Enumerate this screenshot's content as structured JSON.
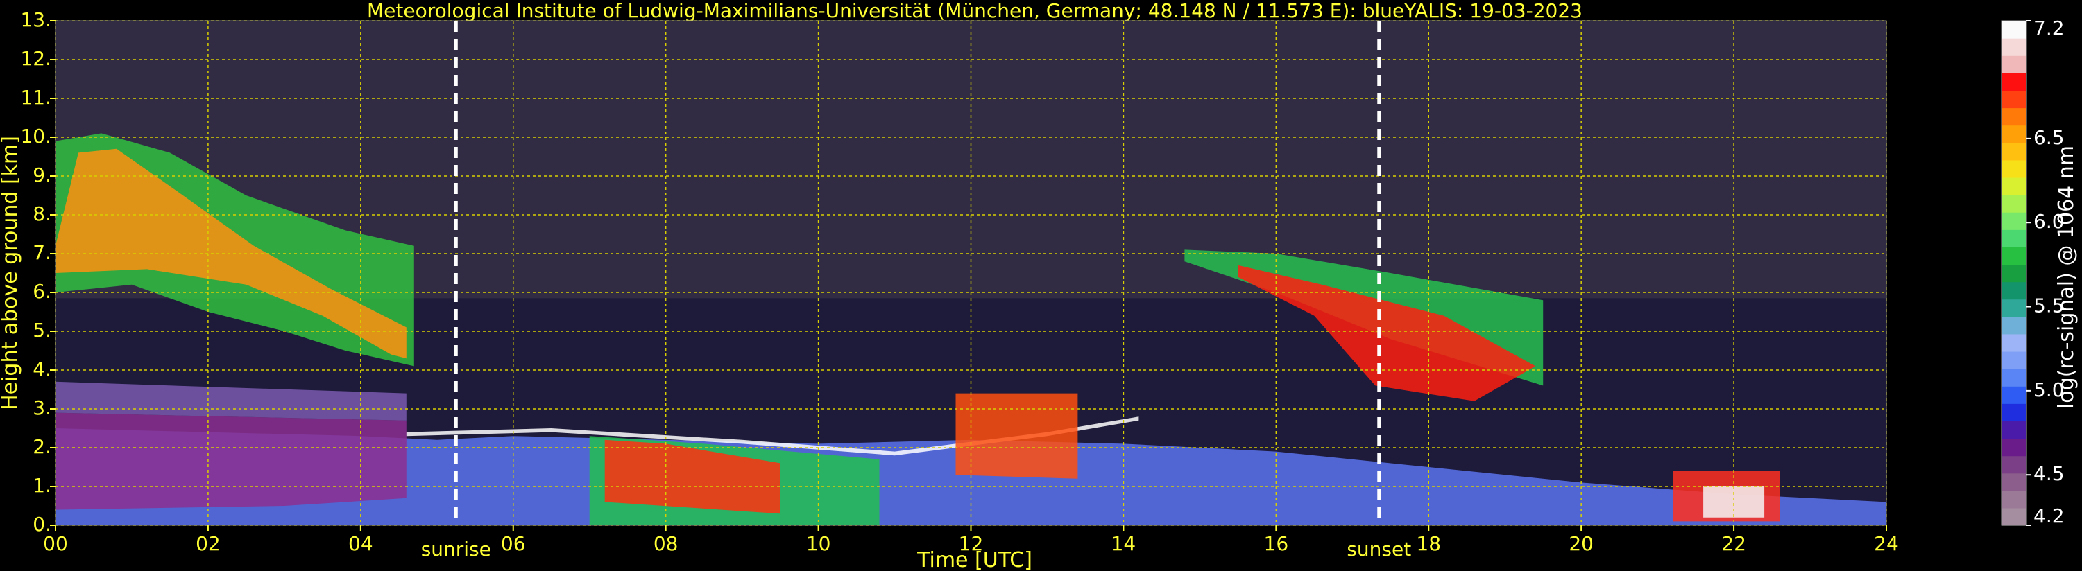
{
  "chart_data": {
    "type": "heatmap",
    "title": "Meteorological Institute of Ludwig-Maximilians-Universität (München, Germany; 48.148 N / 11.573 E):     blueYALIS: 19-03-2023",
    "xlabel": "Time [UTC]",
    "ylabel": "Height above ground [km]",
    "xlim": [
      0,
      24
    ],
    "ylim": [
      0,
      13
    ],
    "x_ticks": [
      "00",
      "02",
      "04",
      "06",
      "08",
      "10",
      "12",
      "14",
      "16",
      "18",
      "20",
      "22",
      "24"
    ],
    "y_ticks": [
      "0.",
      "1.",
      "2.",
      "3.",
      "4.",
      "5.",
      "6.",
      "7.",
      "8.",
      "9.",
      "10.",
      "11.",
      "12.",
      "13."
    ],
    "grid": true,
    "annotations": [
      {
        "label": "sunrise",
        "x": 5.25
      },
      {
        "label": "sunset",
        "x": 17.35
      }
    ],
    "colorbar": {
      "label": "log(rc-signal) @ 1064 nm",
      "range": [
        4.2,
        7.2
      ],
      "tick_labels": [
        "4.2",
        "4.5",
        "5.0",
        "5.5",
        "6.0",
        "6.5",
        "7.2"
      ],
      "ticks": [
        4.2,
        4.5,
        5.0,
        5.5,
        6.0,
        6.5,
        7.2
      ],
      "colors": [
        "#a48ea0",
        "#9a7a96",
        "#8c5e8c",
        "#7a3f86",
        "#6a1c8a",
        "#4a1aa8",
        "#1f2fe0",
        "#2f5cf2",
        "#5a86f5",
        "#7f9ef6",
        "#9db5f7",
        "#6fb0d8",
        "#2fa89a",
        "#14946a",
        "#18a040",
        "#28c040",
        "#4cd870",
        "#78e86a",
        "#a8f050",
        "#d8f030",
        "#f8e018",
        "#ffc010",
        "#ffa008",
        "#ff7a08",
        "#ff4010",
        "#ff1010",
        "#f0b8b8",
        "#f5d8d8",
        "#fafafa"
      ]
    },
    "layers": [
      {
        "name": "near-surface aerosol",
        "color": "#5a74ee",
        "poly": [
          [
            0,
            0
          ],
          [
            24,
            0
          ],
          [
            24,
            0.6
          ],
          [
            22,
            0.8
          ],
          [
            20,
            1.1
          ],
          [
            18,
            1.5
          ],
          [
            16,
            1.9
          ],
          [
            14,
            2.1
          ],
          [
            12,
            2.2
          ],
          [
            10,
            2.1
          ],
          [
            8,
            2.2
          ],
          [
            6,
            2.3
          ],
          [
            5,
            2.2
          ],
          [
            4,
            2.3
          ],
          [
            2,
            2.4
          ],
          [
            0,
            2.5
          ]
        ]
      },
      {
        "name": "residual layer",
        "color": "#8c2f90",
        "poly": [
          [
            0,
            0.4
          ],
          [
            3,
            0.5
          ],
          [
            4.6,
            0.7
          ],
          [
            4.6,
            2.7
          ],
          [
            0,
            2.9
          ]
        ]
      },
      {
        "name": "upper aerosol",
        "color": "#7a5ab0",
        "poly": [
          [
            0,
            2.9
          ],
          [
            4.6,
            2.7
          ],
          [
            4.6,
            3.4
          ],
          [
            0,
            3.7
          ]
        ]
      },
      {
        "name": "cirrus morning",
        "color": "#30c040",
        "poly": [
          [
            0,
            6
          ],
          [
            1,
            6.2
          ],
          [
            2,
            5.5
          ],
          [
            3,
            5
          ],
          [
            3.8,
            4.5
          ],
          [
            4.7,
            4.1
          ],
          [
            4.7,
            7.2
          ],
          [
            3.8,
            7.6
          ],
          [
            2.5,
            8.5
          ],
          [
            1.5,
            9.6
          ],
          [
            0.6,
            10.1
          ],
          [
            0,
            9.9
          ]
        ]
      },
      {
        "name": "cirrus morning core",
        "color": "#ff9010",
        "poly": [
          [
            0,
            6.5
          ],
          [
            1.2,
            6.6
          ],
          [
            2.5,
            6.2
          ],
          [
            3.5,
            5.4
          ],
          [
            4.4,
            4.4
          ],
          [
            4.6,
            4.3
          ],
          [
            4.6,
            5.1
          ],
          [
            3.6,
            6.1
          ],
          [
            2.6,
            7.2
          ],
          [
            1.6,
            8.6
          ],
          [
            0.8,
            9.7
          ],
          [
            0.3,
            9.6
          ],
          [
            0,
            7.2
          ]
        ]
      },
      {
        "name": "boundary layer top",
        "color": "#ffffff",
        "poly": [
          [
            4.6,
            2.3
          ],
          [
            6.5,
            2.4
          ],
          [
            9,
            2.1
          ],
          [
            11,
            1.8
          ],
          [
            13,
            2.3
          ],
          [
            14.2,
            2.7
          ],
          [
            14.2,
            2.8
          ],
          [
            13,
            2.4
          ],
          [
            11,
            1.9
          ],
          [
            9,
            2.2
          ],
          [
            6.5,
            2.5
          ],
          [
            4.6,
            2.4
          ]
        ]
      },
      {
        "name": "convective clouds",
        "color": "#22c050",
        "poly": [
          [
            7,
            0
          ],
          [
            10.8,
            0
          ],
          [
            10.8,
            1.7
          ],
          [
            8.5,
            2.1
          ],
          [
            7,
            2.3
          ]
        ]
      },
      {
        "name": "convective clouds core",
        "color": "#ff3010",
        "poly": [
          [
            7.2,
            0.6
          ],
          [
            9.5,
            0.3
          ],
          [
            9.5,
            1.6
          ],
          [
            8,
            2.1
          ],
          [
            7.2,
            2.2
          ]
        ]
      },
      {
        "name": "clouds noon",
        "color": "#ff5010",
        "poly": [
          [
            11.8,
            1.3
          ],
          [
            13.4,
            1.2
          ],
          [
            13.4,
            3.4
          ],
          [
            11.8,
            3.4
          ]
        ]
      },
      {
        "name": "afternoon cloud layer",
        "color": "#28c050",
        "poly": [
          [
            14.8,
            6.8
          ],
          [
            16,
            6
          ],
          [
            17.5,
            4.8
          ],
          [
            19.5,
            3.6
          ],
          [
            19.5,
            5.8
          ],
          [
            17.5,
            6.5
          ],
          [
            16,
            7
          ],
          [
            14.8,
            7.1
          ]
        ]
      },
      {
        "name": "afternoon cloud core",
        "color": "#ff2010",
        "poly": [
          [
            15.5,
            6.4
          ],
          [
            16.5,
            5.4
          ],
          [
            17.3,
            3.6
          ],
          [
            18.6,
            3.2
          ],
          [
            19.4,
            4.1
          ],
          [
            18.2,
            5.4
          ],
          [
            16.6,
            6.2
          ],
          [
            15.5,
            6.7
          ]
        ]
      },
      {
        "name": "evening clouds",
        "color": "#ff3020",
        "poly": [
          [
            21.2,
            0.1
          ],
          [
            22.6,
            0.1
          ],
          [
            22.6,
            1.4
          ],
          [
            21.2,
            1.4
          ]
        ]
      },
      {
        "name": "evening cloud core",
        "color": "#f5f5f5",
        "poly": [
          [
            21.6,
            0.2
          ],
          [
            22.4,
            0.2
          ],
          [
            22.4,
            1.0
          ],
          [
            21.6,
            1.0
          ]
        ]
      }
    ]
  }
}
